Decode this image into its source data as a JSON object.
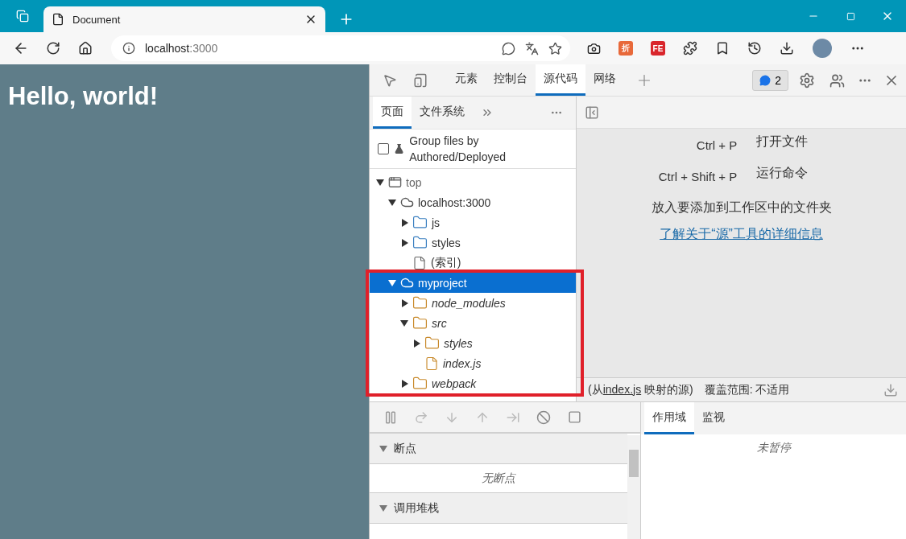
{
  "browser": {
    "tab_title": "Document",
    "url_host": "localhost",
    "url_port": ":3000",
    "extensions": [
      {
        "label": "折",
        "color": "#e8693a"
      },
      {
        "label": "FE",
        "color": "#d9262c"
      }
    ]
  },
  "page": {
    "heading": "Hello, world!"
  },
  "devtools": {
    "tabs": [
      {
        "label": "元素",
        "selected": false
      },
      {
        "label": "控制台",
        "selected": false
      },
      {
        "label": "源代码",
        "selected": true
      },
      {
        "label": "网络",
        "selected": false
      }
    ],
    "issues_count": "2",
    "navigator_tabs": [
      {
        "label": "页面",
        "selected": true
      },
      {
        "label": "文件系统",
        "selected": false
      }
    ],
    "group_files": {
      "label": "Group files by Authored/Deployed",
      "checked": false
    },
    "tree": [
      {
        "label": "top",
        "kind": "frame",
        "expanded": true,
        "selected": false,
        "authored": false,
        "children": [
          {
            "label": "localhost:3000",
            "kind": "origin",
            "expanded": true,
            "selected": false,
            "authored": false,
            "children": [
              {
                "label": "js",
                "kind": "folder",
                "expanded": false,
                "selected": false,
                "authored": false
              },
              {
                "label": "styles",
                "kind": "folder",
                "expanded": false,
                "selected": false,
                "authored": false
              },
              {
                "label": "(索引)",
                "kind": "file",
                "selected": false,
                "authored": false
              }
            ]
          },
          {
            "label": "myproject",
            "kind": "origin",
            "expanded": true,
            "selected": true,
            "authored": false,
            "highlighted": true,
            "children": [
              {
                "label": "node_modules",
                "kind": "folder",
                "expanded": false,
                "selected": false,
                "authored": true
              },
              {
                "label": "src",
                "kind": "folder",
                "expanded": true,
                "selected": false,
                "authored": true,
                "children": [
                  {
                    "label": "styles",
                    "kind": "folder",
                    "expanded": false,
                    "selected": false,
                    "authored": true
                  },
                  {
                    "label": "index.js",
                    "kind": "file",
                    "selected": false,
                    "authored": true
                  }
                ]
              },
              {
                "label": "webpack",
                "kind": "folder",
                "expanded": false,
                "selected": false,
                "authored": true
              }
            ]
          }
        ]
      }
    ],
    "editor": {
      "shortcuts": [
        {
          "keys": "Ctrl + P",
          "action": "打开文件"
        },
        {
          "keys": "Ctrl + Shift + P",
          "action": "运行命令"
        }
      ],
      "drop_hint": "放入要添加到工作区中的文件夹",
      "link": "了解关于“源”工具的详细信息"
    },
    "status": {
      "prefix": "(从",
      "link": "index.js",
      "suffix": " 映射的源)",
      "coverage": "覆盖范围: 不适用"
    },
    "debug_sections": [
      {
        "title": "断点",
        "expanded": true,
        "message": "无断点"
      },
      {
        "title": "调用堆栈",
        "expanded": true
      }
    ],
    "side_tabs": [
      {
        "label": "作用域",
        "selected": true
      },
      {
        "label": "监视",
        "selected": false
      }
    ],
    "side_message": "未暂停"
  }
}
